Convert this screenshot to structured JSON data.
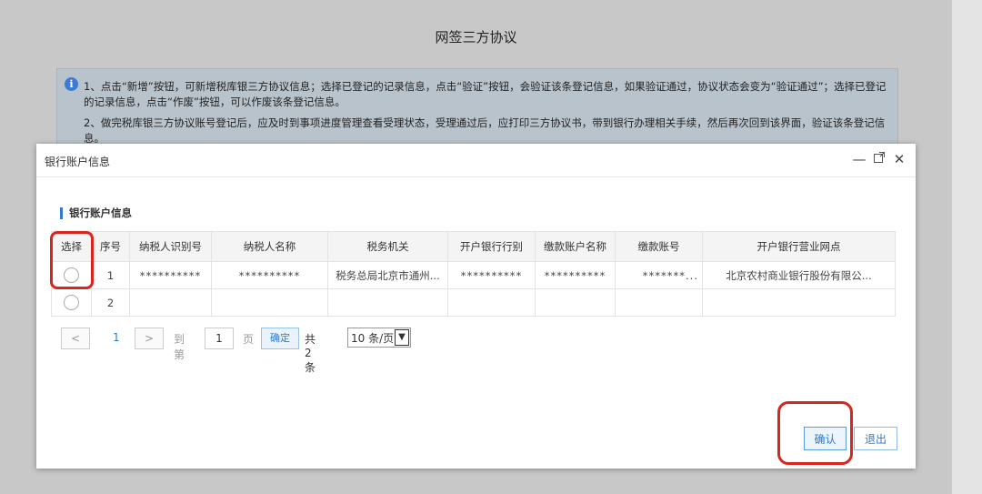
{
  "page": {
    "title": "网签三方协议"
  },
  "notice": {
    "line1": "1、点击“新增”按钮，可新增税库银三方协议信息；选择已登记的记录信息，点击“验证”按钮，会验证该条登记信息，如果验证通过，协议状态会变为“验证通过”；选择已登记的记录信息，点击“作废”按钮，可以作废该条登记信息。",
    "line2": "2、做完税库银三方协议账号登记后，应及时到事项进度管理查看受理状态，受理通过后，应打印三方协议书，带到银行办理相关手续，然后再次回到该界面，验证该条登记信息。"
  },
  "modal": {
    "title": "银行账户信息",
    "section_title": "银行账户信息",
    "header_icons": [
      "minimize-icon",
      "maximize-icon",
      "close-icon"
    ]
  },
  "table": {
    "columns": [
      "选择",
      "序号",
      "纳税人识别号",
      "纳税人名称",
      "税务机关",
      "开户银行行别",
      "缴款账户名称",
      "缴款账号",
      "开户银行营业网点"
    ],
    "rows": [
      {
        "index": "1",
        "taxpayer_id": "**********",
        "taxpayer_name": "**********",
        "tax_authority": "税务总局北京市通州...",
        "bank_type": "**********",
        "account_name": "**********",
        "account_no": "*******...",
        "bank_branch": "北京农村商业银行股份有限公..."
      },
      {
        "index": "2",
        "taxpayer_id": "",
        "taxpayer_name": "",
        "tax_authority": "",
        "bank_type": "",
        "account_name": "",
        "account_no": "",
        "bank_branch": ""
      }
    ]
  },
  "pager": {
    "current_page": "1",
    "goto_label": "到第",
    "page_input": "1",
    "page_unit": "页",
    "confirm_label": "确定",
    "total_label": "共 2 条",
    "page_size": "10 条/页"
  },
  "buttons": {
    "confirm": "确认",
    "exit": "退出"
  },
  "colors": {
    "accent": "#2e7bd0",
    "highlight": "#d8261f"
  }
}
